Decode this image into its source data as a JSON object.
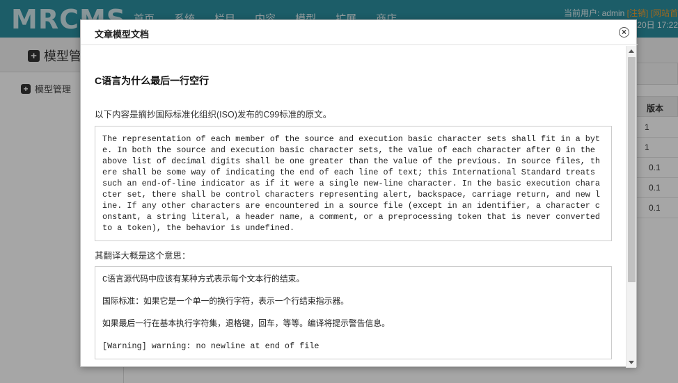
{
  "app": {
    "logo": "MRCMS",
    "nav": [
      "首页",
      "系统",
      "栏目",
      "内容",
      "模型",
      "扩展",
      "商店"
    ],
    "user_label": "当前用户: admin",
    "logout": "[注销]",
    "site_link": "[网站首",
    "date_fragment": "20日 17:22"
  },
  "page": {
    "header_title": "模型管",
    "sidebar_item": "模型管理",
    "table": {
      "version_header": "版本",
      "versions": [
        "1",
        "1",
        "0.1",
        "0.1",
        "0.1"
      ]
    }
  },
  "modal": {
    "title": "文章模型文档",
    "article_title": "C语言为什么最后一行空行",
    "intro": "以下内容是摘抄国际标准化组织(ISO)发布的C99标准的原文。",
    "quote": "The representation of each member of the source and execution basic character sets shall fit in a byte. In both the source and execution basic character sets, the value of each character after 0 in the above list of decimal digits shall be one greater than the value of the previous. In source files, there shall be some way of indicating the end of each line of text; this International Standard treats such an end-of-line indicator as if it were a single new-line character. In the basic execution character set, there shall be control characters representing alert, backspace, carriage return, and new line. If any other characters are encountered in a source file (except in an identifier, a character constant, a string literal, a header name, a comment, or a preprocessing token that is never converted to a token), the behavior is undefined.",
    "translate_label": "其翻译大概是这个意思：",
    "translation": [
      "C语言源代码中应该有某种方式表示每个文本行的结束。",
      "国际标准：如果它是一个单一的换行字符，表示一个行结束指示器。",
      "如果最后一行在基本执行字符集，退格键，回车，等等。编译将提示警告信息。",
      "[Warning] warning: no newline at end of file"
    ]
  }
}
